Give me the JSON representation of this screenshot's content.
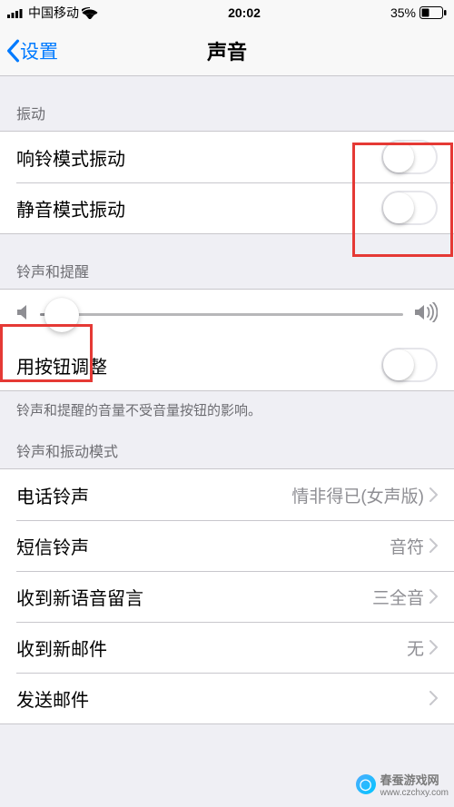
{
  "status": {
    "carrier": "中国移动",
    "time": "20:02",
    "battery_pct": "35%"
  },
  "nav": {
    "back_label": "设置",
    "title": "声音"
  },
  "sections": {
    "vibration": {
      "header": "振动",
      "ring_vibrate": "响铃模式振动",
      "silent_vibrate": "静音模式振动"
    },
    "ringer": {
      "header": "铃声和提醒",
      "change_with_buttons": "用按钮调整",
      "footer": "铃声和提醒的音量不受音量按钮的影响。"
    },
    "patterns": {
      "header": "铃声和振动模式",
      "items": {
        "ringtone": {
          "label": "电话铃声",
          "value": "情非得已(女声版)"
        },
        "text_tone": {
          "label": "短信铃声",
          "value": "音符"
        },
        "voicemail": {
          "label": "收到新语音留言",
          "value": "三全音"
        },
        "new_mail": {
          "label": "收到新邮件",
          "value": "无"
        },
        "sent_mail": {
          "label": "发送邮件",
          "value": ""
        }
      }
    }
  },
  "watermark": {
    "text": "春蚕游戏网",
    "url": "www.czchxy.com"
  }
}
